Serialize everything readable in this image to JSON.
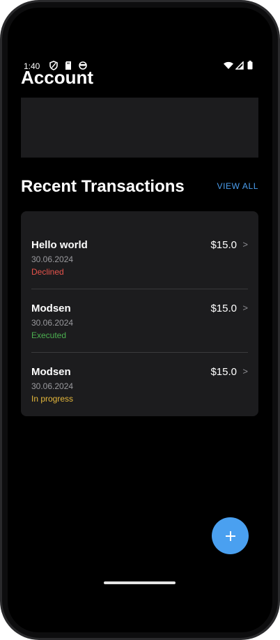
{
  "status_bar": {
    "time": "1:40",
    "left_icons": [
      "shield-icon",
      "sd-card-icon",
      "cloud-icon"
    ],
    "right_icons": [
      "wifi-icon",
      "signal-icon",
      "battery-icon"
    ]
  },
  "page": {
    "title": "Account"
  },
  "transactions": {
    "section_title": "Recent Transactions",
    "view_all_label": "VIEW ALL",
    "items": [
      {
        "name": "Hello world",
        "date": "30.06.2024",
        "status": "Declined",
        "amount": "$15.0",
        "chevron": ">"
      },
      {
        "name": "Modsen",
        "date": "30.06.2024",
        "status": "Executed",
        "amount": "$15.0",
        "chevron": ">"
      },
      {
        "name": "Modsen",
        "date": "30.06.2024",
        "status": "In progress",
        "amount": "$15.0",
        "chevron": ">"
      }
    ]
  },
  "fab": {
    "icon": "plus-icon"
  },
  "colors": {
    "background": "#000000",
    "card": "#1c1c1e",
    "accent": "#4b9ff0",
    "declined": "#e5534b",
    "executed": "#4caf50",
    "in_progress": "#e6b93c",
    "secondary_text": "#9a9a9e"
  }
}
